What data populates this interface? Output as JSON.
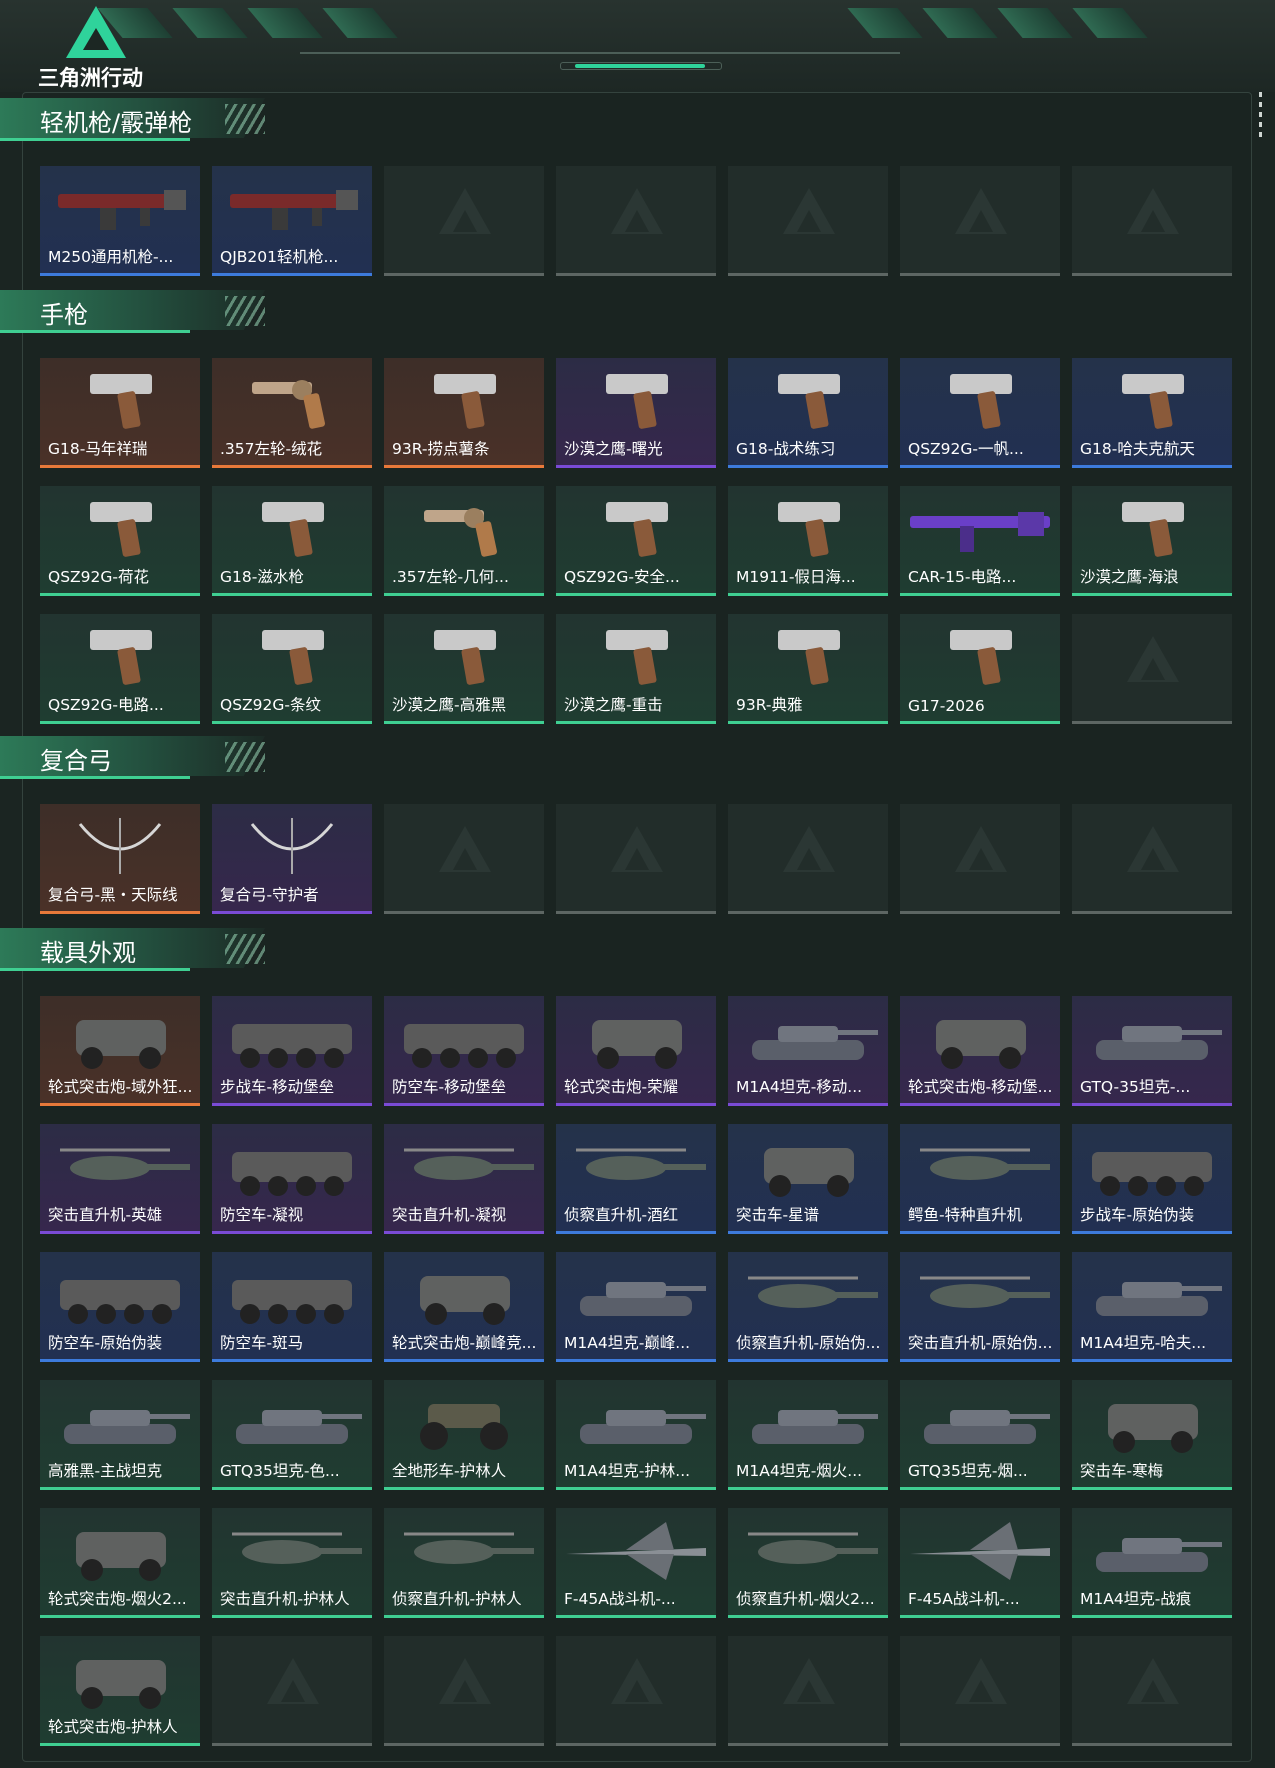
{
  "app": {
    "logo_text": "三角洲行动"
  },
  "colors": {
    "orange": "#e8793a",
    "purple": "#7a4bd6",
    "blue": "#3d7bdc",
    "green": "#3fcf92",
    "empty": "#5d6663",
    "accent": "#2fd39b"
  },
  "sections": [
    {
      "title": "轻机枪/霰弹枪",
      "items": [
        {
          "label": "M250通用机枪-...",
          "rarity": "blue",
          "icon": "machine-gun-icon"
        },
        {
          "label": "QJB201轻机枪...",
          "rarity": "blue",
          "icon": "machine-gun-icon"
        },
        {
          "label": "",
          "rarity": "empty"
        },
        {
          "label": "",
          "rarity": "empty"
        },
        {
          "label": "",
          "rarity": "empty"
        },
        {
          "label": "",
          "rarity": "empty"
        },
        {
          "label": "",
          "rarity": "empty"
        }
      ]
    },
    {
      "title": "手枪",
      "items": [
        {
          "label": "G18-马年祥瑞",
          "rarity": "orange",
          "icon": "pistol-icon"
        },
        {
          "label": ".357左轮-绒花",
          "rarity": "orange",
          "icon": "revolver-icon"
        },
        {
          "label": "93R-捞点薯条",
          "rarity": "orange",
          "icon": "pistol-icon"
        },
        {
          "label": "沙漠之鹰-曙光",
          "rarity": "purple",
          "icon": "pistol-icon"
        },
        {
          "label": "G18-战术练习",
          "rarity": "blue",
          "icon": "pistol-icon"
        },
        {
          "label": "QSZ92G-一帆...",
          "rarity": "blue",
          "icon": "pistol-icon"
        },
        {
          "label": "G18-哈夫克航天",
          "rarity": "blue",
          "icon": "pistol-icon"
        },
        {
          "label": "QSZ92G-荷花",
          "rarity": "green",
          "icon": "pistol-icon"
        },
        {
          "label": "G18-滋水枪",
          "rarity": "green",
          "icon": "pistol-icon"
        },
        {
          "label": ".357左轮-几何...",
          "rarity": "green",
          "icon": "revolver-icon"
        },
        {
          "label": "QSZ92G-安全...",
          "rarity": "green",
          "icon": "pistol-icon"
        },
        {
          "label": "M1911-假日海...",
          "rarity": "green",
          "icon": "pistol-icon"
        },
        {
          "label": "CAR-15-电路...",
          "rarity": "green",
          "icon": "rifle-icon"
        },
        {
          "label": "沙漠之鹰-海浪",
          "rarity": "green",
          "icon": "pistol-icon"
        },
        {
          "label": "QSZ92G-电路...",
          "rarity": "green",
          "icon": "pistol-icon"
        },
        {
          "label": "QSZ92G-条纹",
          "rarity": "green",
          "icon": "pistol-icon"
        },
        {
          "label": "沙漠之鹰-高雅黑",
          "rarity": "green",
          "icon": "pistol-icon"
        },
        {
          "label": "沙漠之鹰-重击",
          "rarity": "green",
          "icon": "pistol-icon"
        },
        {
          "label": "93R-典雅",
          "rarity": "green",
          "icon": "pistol-icon"
        },
        {
          "label": "G17-2026",
          "rarity": "green",
          "icon": "pistol-icon"
        },
        {
          "label": "",
          "rarity": "empty"
        }
      ]
    },
    {
      "title": "复合弓",
      "items": [
        {
          "label": "复合弓-黑・天际线",
          "rarity": "orange",
          "icon": "bow-icon"
        },
        {
          "label": "复合弓-守护者",
          "rarity": "purple",
          "icon": "bow-icon"
        },
        {
          "label": "",
          "rarity": "empty"
        },
        {
          "label": "",
          "rarity": "empty"
        },
        {
          "label": "",
          "rarity": "empty"
        },
        {
          "label": "",
          "rarity": "empty"
        },
        {
          "label": "",
          "rarity": "empty"
        }
      ]
    },
    {
      "title": "载具外观",
      "items": [
        {
          "label": "轮式突击炮-域外狂...",
          "rarity": "orange",
          "icon": "armored-car-icon"
        },
        {
          "label": "步战车-移动堡垒",
          "rarity": "purple",
          "icon": "apc-icon"
        },
        {
          "label": "防空车-移动堡垒",
          "rarity": "purple",
          "icon": "apc-icon"
        },
        {
          "label": "轮式突击炮-荣耀",
          "rarity": "purple",
          "icon": "armored-car-icon"
        },
        {
          "label": "M1A4坦克-移动...",
          "rarity": "purple",
          "icon": "tank-icon"
        },
        {
          "label": "轮式突击炮-移动堡...",
          "rarity": "purple",
          "icon": "armored-car-icon"
        },
        {
          "label": "GTQ-35坦克-...",
          "rarity": "purple",
          "icon": "tank-icon"
        },
        {
          "label": "突击直升机-英雄",
          "rarity": "purple",
          "icon": "helicopter-icon"
        },
        {
          "label": "防空车-凝视",
          "rarity": "purple",
          "icon": "apc-icon"
        },
        {
          "label": "突击直升机-凝视",
          "rarity": "purple",
          "icon": "helicopter-icon"
        },
        {
          "label": "侦察直升机-酒红",
          "rarity": "blue",
          "icon": "helicopter-icon"
        },
        {
          "label": "突击车-星谱",
          "rarity": "blue",
          "icon": "armored-car-icon"
        },
        {
          "label": "鳄鱼-特种直升机",
          "rarity": "blue",
          "icon": "helicopter-icon"
        },
        {
          "label": "步战车-原始伪装",
          "rarity": "blue",
          "icon": "apc-icon"
        },
        {
          "label": "防空车-原始伪装",
          "rarity": "blue",
          "icon": "apc-icon"
        },
        {
          "label": "防空车-斑马",
          "rarity": "blue",
          "icon": "apc-icon"
        },
        {
          "label": "轮式突击炮-巅峰竞...",
          "rarity": "blue",
          "icon": "armored-car-icon"
        },
        {
          "label": "M1A4坦克-巅峰...",
          "rarity": "blue",
          "icon": "tank-icon"
        },
        {
          "label": "侦察直升机-原始伪...",
          "rarity": "blue",
          "icon": "helicopter-icon"
        },
        {
          "label": "突击直升机-原始伪...",
          "rarity": "blue",
          "icon": "helicopter-icon"
        },
        {
          "label": "M1A4坦克-哈夫...",
          "rarity": "blue",
          "icon": "tank-icon"
        },
        {
          "label": "高雅黑-主战坦克",
          "rarity": "green",
          "icon": "tank-icon"
        },
        {
          "label": "GTQ35坦克-色...",
          "rarity": "green",
          "icon": "tank-icon"
        },
        {
          "label": "全地形车-护林人",
          "rarity": "green",
          "icon": "atv-icon"
        },
        {
          "label": "M1A4坦克-护林...",
          "rarity": "green",
          "icon": "tank-icon"
        },
        {
          "label": "M1A4坦克-烟火...",
          "rarity": "green",
          "icon": "tank-icon"
        },
        {
          "label": "GTQ35坦克-烟...",
          "rarity": "green",
          "icon": "tank-icon"
        },
        {
          "label": "突击车-寒梅",
          "rarity": "green",
          "icon": "armored-car-icon"
        },
        {
          "label": "轮式突击炮-烟火2...",
          "rarity": "green",
          "icon": "armored-car-icon"
        },
        {
          "label": "突击直升机-护林人",
          "rarity": "green",
          "icon": "helicopter-icon"
        },
        {
          "label": "侦察直升机-护林人",
          "rarity": "green",
          "icon": "helicopter-icon"
        },
        {
          "label": "F-45A战斗机-...",
          "rarity": "green",
          "icon": "jet-icon"
        },
        {
          "label": "侦察直升机-烟火2...",
          "rarity": "green",
          "icon": "helicopter-icon"
        },
        {
          "label": "F-45A战斗机-...",
          "rarity": "green",
          "icon": "jet-icon"
        },
        {
          "label": "M1A4坦克-战痕",
          "rarity": "green",
          "icon": "tank-icon"
        },
        {
          "label": "轮式突击炮-护林人",
          "rarity": "green",
          "icon": "armored-car-icon"
        },
        {
          "label": "",
          "rarity": "empty"
        },
        {
          "label": "",
          "rarity": "empty"
        },
        {
          "label": "",
          "rarity": "empty"
        },
        {
          "label": "",
          "rarity": "empty"
        },
        {
          "label": "",
          "rarity": "empty"
        },
        {
          "label": "",
          "rarity": "empty"
        }
      ]
    }
  ]
}
